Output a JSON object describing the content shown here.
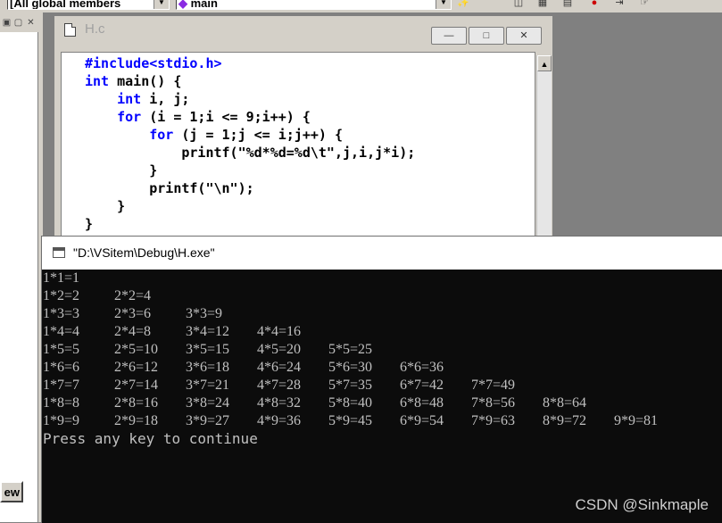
{
  "toolbar": {
    "class_combo": "[All global members",
    "member_combo": "main"
  },
  "left_pane": {
    "view_tab_label": "ew"
  },
  "editor": {
    "title": "H.c",
    "code_lines": [
      {
        "parts": [
          {
            "t": "#include<stdio.h>",
            "k": true
          }
        ]
      },
      {
        "parts": [
          {
            "t": "int",
            "k": true
          },
          {
            "t": " main() {"
          }
        ]
      },
      {
        "parts": [
          {
            "t": "    "
          },
          {
            "t": "int",
            "k": true
          },
          {
            "t": " i, j;"
          }
        ]
      },
      {
        "parts": [
          {
            "t": "    "
          },
          {
            "t": "for",
            "k": true
          },
          {
            "t": " (i = 1;i <= 9;i++) {"
          }
        ]
      },
      {
        "parts": [
          {
            "t": "        "
          },
          {
            "t": "for",
            "k": true
          },
          {
            "t": " (j = 1;j <= i;j++) {"
          }
        ]
      },
      {
        "parts": [
          {
            "t": "            printf(\"%d*%d=%d\\t\",j,i,j*i);"
          }
        ]
      },
      {
        "parts": [
          {
            "t": "        }"
          }
        ]
      },
      {
        "parts": [
          {
            "t": "        printf(\"\\n\");"
          }
        ]
      },
      {
        "parts": [
          {
            "t": "    }"
          }
        ]
      },
      {
        "parts": [
          {
            "t": "}"
          }
        ]
      }
    ]
  },
  "console": {
    "title": "\"D:\\VSitem\\Debug\\H.exe\"",
    "rows": [
      [
        "1*1=1"
      ],
      [
        "1*2=2",
        "2*2=4"
      ],
      [
        "1*3=3",
        "2*3=6",
        "3*3=9"
      ],
      [
        "1*4=4",
        "2*4=8",
        "3*4=12",
        "4*4=16"
      ],
      [
        "1*5=5",
        "2*5=10",
        "3*5=15",
        "4*5=20",
        "5*5=25"
      ],
      [
        "1*6=6",
        "2*6=12",
        "3*6=18",
        "4*6=24",
        "5*6=30",
        "6*6=36"
      ],
      [
        "1*7=7",
        "2*7=14",
        "3*7=21",
        "4*7=28",
        "5*7=35",
        "6*7=42",
        "7*7=49"
      ],
      [
        "1*8=8",
        "2*8=16",
        "3*8=24",
        "4*8=32",
        "5*8=40",
        "6*8=48",
        "7*8=56",
        "8*8=64"
      ],
      [
        "1*9=9",
        "2*9=18",
        "3*9=27",
        "4*9=36",
        "5*9=45",
        "6*9=54",
        "7*9=63",
        "8*9=72",
        "9*9=81"
      ]
    ],
    "prompt": "Press any key to continue"
  },
  "watermark": "CSDN @Sinkmaple",
  "colors": {
    "keyword": "#0000ff",
    "console_bg": "#0c0c0c",
    "console_text": "#c0c0c0"
  }
}
